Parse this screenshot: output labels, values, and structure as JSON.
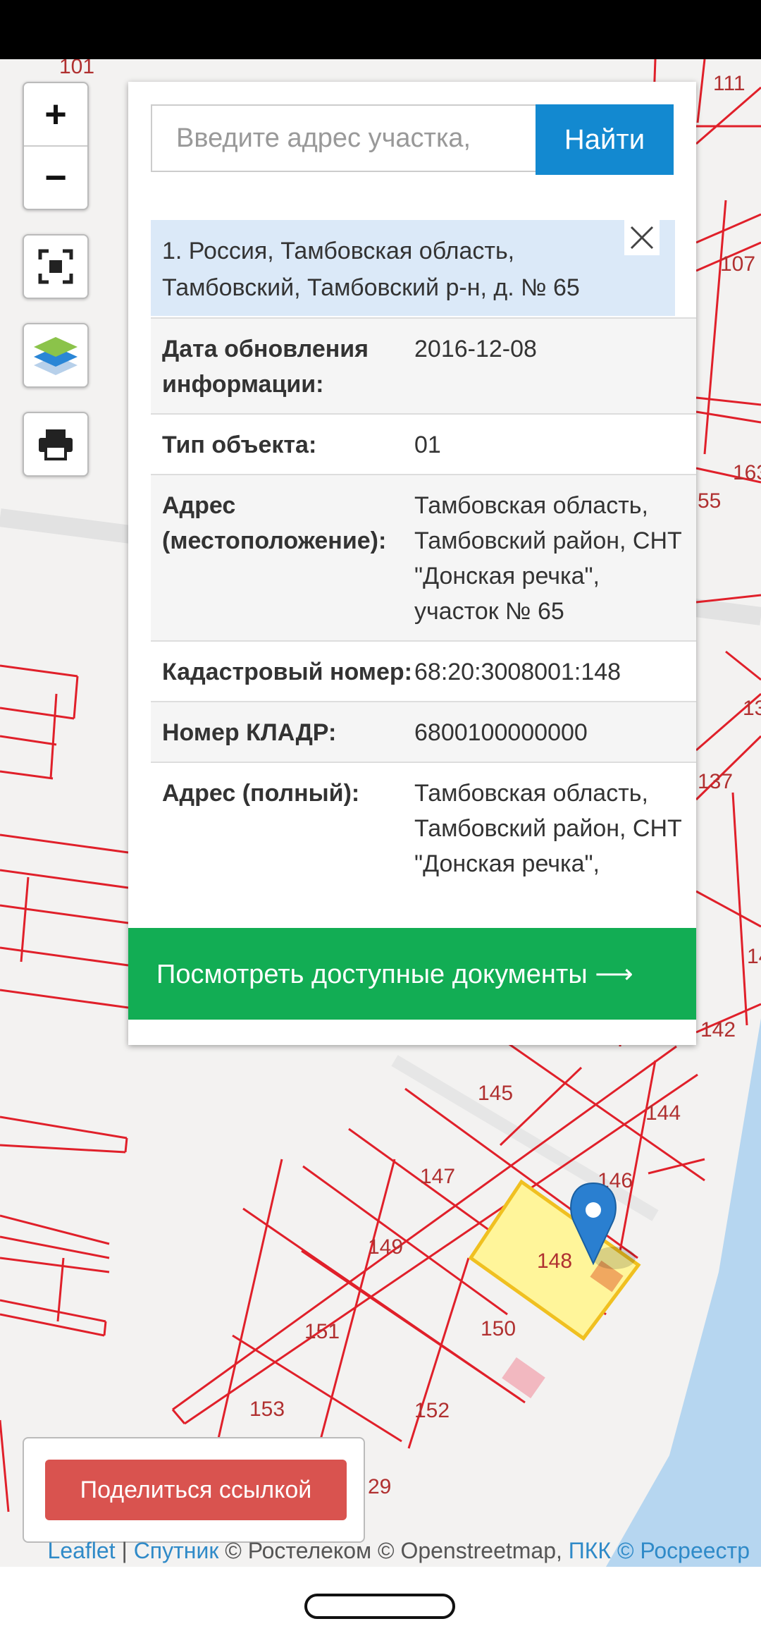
{
  "map": {
    "parcel_labels": [
      "101",
      "111",
      "107",
      "163",
      "55",
      "13",
      "137",
      "14",
      "142",
      "145",
      "144",
      "146",
      "147",
      "149",
      "148",
      "151",
      "150",
      "153",
      "152",
      "29"
    ]
  },
  "controls": {
    "zoom_in": "+",
    "zoom_out": "−"
  },
  "search": {
    "placeholder": "Введите адрес участка,",
    "button_label": "Найти"
  },
  "result": {
    "title": "1. Россия, Тамбовская область, Тамбовский, Тамбовский р-н, д. № 65"
  },
  "details": [
    {
      "label": "Дата обновления информации:",
      "value": "2016-12-08"
    },
    {
      "label": "Тип объекта:",
      "value": "01"
    },
    {
      "label": "Адрес (местоположение):",
      "value": "Тамбовская область,\nТамбовский район, СНТ\n\"Донская речка\",\nучасток № 65"
    },
    {
      "label": "Кадастровый номер:",
      "value": "68:20:3008001:148"
    },
    {
      "label": "Номер КЛАДР:",
      "value": "6800100000000"
    },
    {
      "label": "Адрес (полный):",
      "value": "Тамбовская область,\nТамбовский район, СНТ\n\"Донская речка\","
    }
  ],
  "docs_button_label": "Посмотреть доступные документы ⟶",
  "share_button_label": "Поделиться ссылкой",
  "attribution": {
    "leaflet": "Leaflet",
    "sep1": " | ",
    "sputnik": "Спутник",
    "middle": " © Ростелеком © Openstreetmap, ",
    "pkk": "ПКК © Росреестр"
  },
  "colors": {
    "search_button": "#1389d0",
    "docs_button": "#12ad54",
    "share_button": "#d9534f",
    "parcel_lines": "#e0202a",
    "selected_parcel": "#fff59a",
    "water": "#b6d6f0",
    "marker": "#2a7fd0"
  }
}
